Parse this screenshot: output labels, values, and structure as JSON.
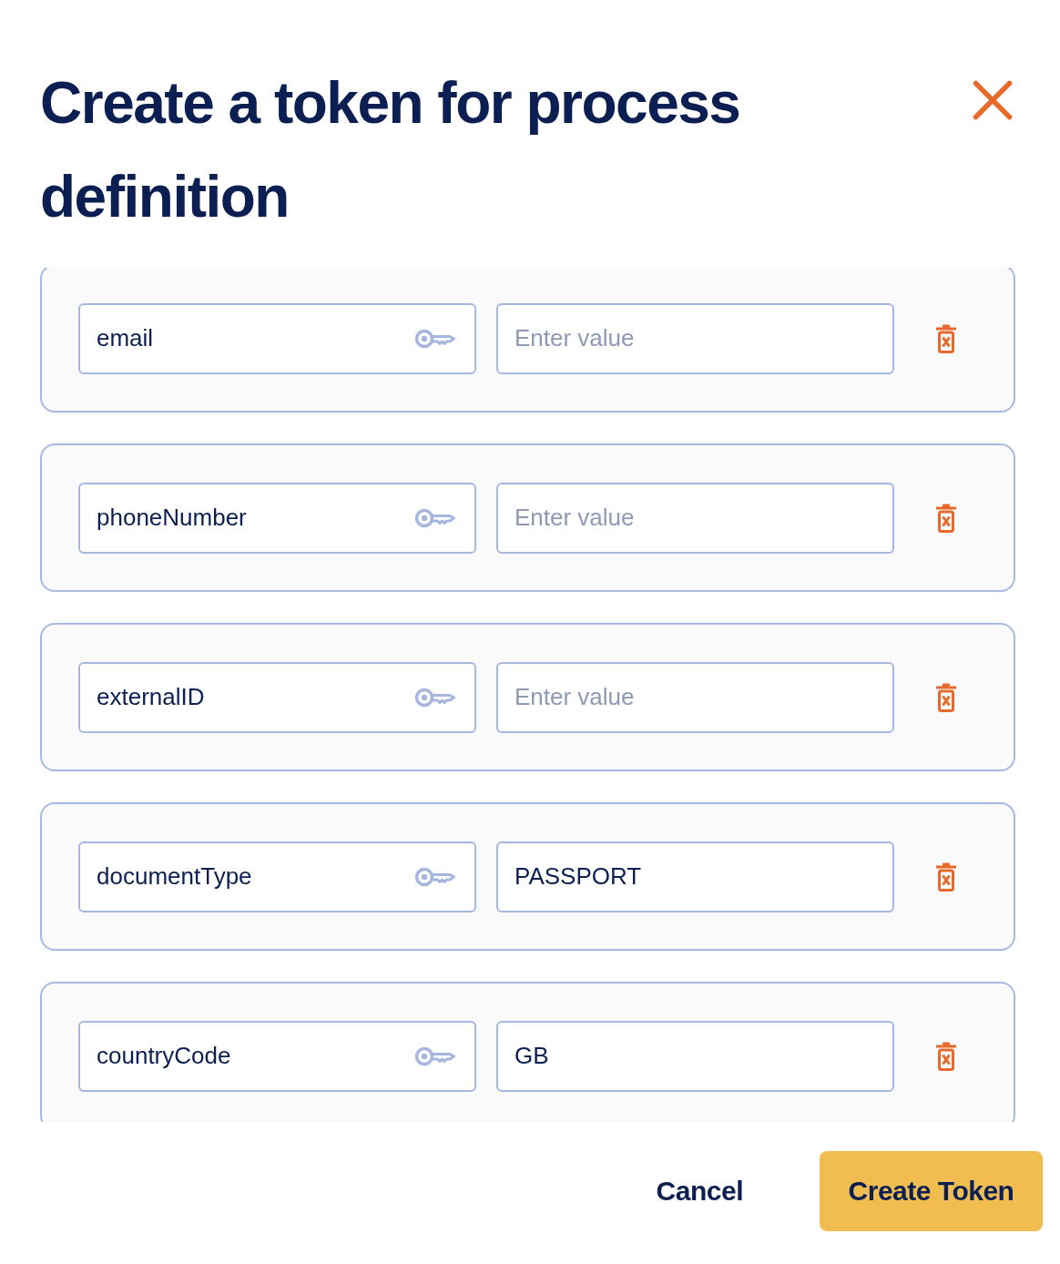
{
  "dialog": {
    "title": "Create a token for process definition"
  },
  "rows": [
    {
      "key": "email",
      "placeholder": "Enter value"
    },
    {
      "key": "phoneNumber",
      "placeholder": "Enter value"
    },
    {
      "key": "externalID",
      "placeholder": "Enter value"
    },
    {
      "key": "documentType",
      "value": "PASSPORT"
    },
    {
      "key": "countryCode",
      "value": "GB"
    }
  ],
  "buttons": [
    {
      "label": "Cancel",
      "kind": "secondary"
    },
    {
      "label": "Create Token",
      "kind": "primary"
    }
  ]
}
